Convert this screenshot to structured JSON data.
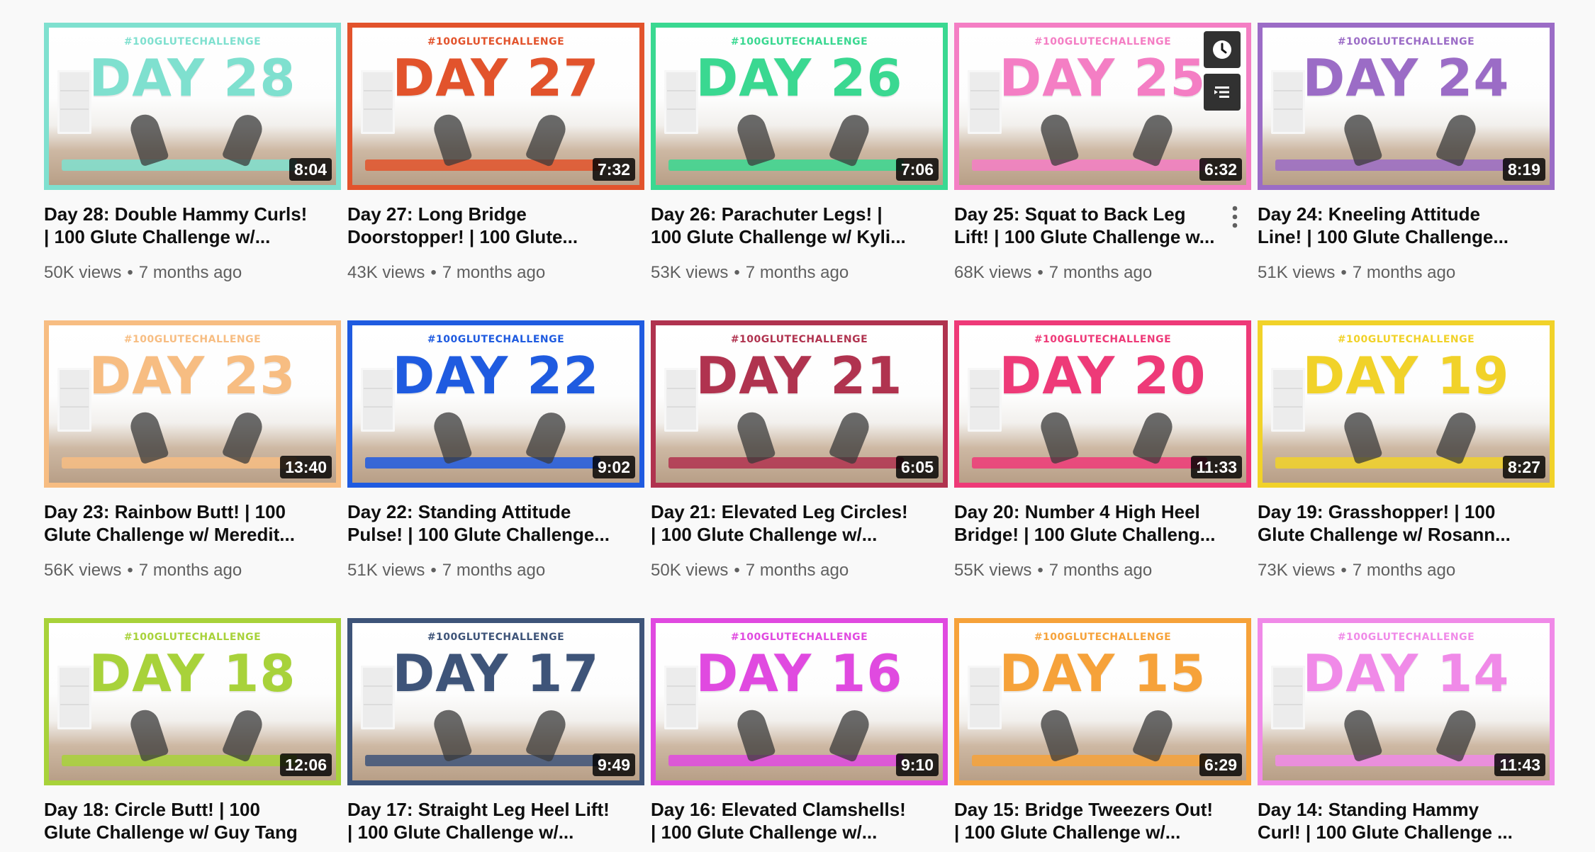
{
  "videos": [
    {
      "tag": "#100GLUTECHALLENGE",
      "day": "DAY 28",
      "color": "#7fe0cf",
      "duration": "8:04",
      "title_line1": "Day 28: Double Hammy Curls!",
      "title_line2": "| 100 Glute Challenge w/...",
      "views": "50K views",
      "age": "7 months ago"
    },
    {
      "tag": "#100GLUTECHALLENGE",
      "day": "DAY 27",
      "color": "#e2532c",
      "duration": "7:32",
      "title_line1": "Day 27: Long Bridge",
      "title_line2": "Doorstopper! | 100 Glute...",
      "views": "43K views",
      "age": "7 months ago"
    },
    {
      "tag": "#100GLUTECHALLENGE",
      "day": "DAY 26",
      "color": "#3ad891",
      "duration": "7:06",
      "title_line1": "Day 26: Parachuter Legs! |",
      "title_line2": "100 Glute Challenge w/ Kyli...",
      "views": "53K views",
      "age": "7 months ago"
    },
    {
      "tag": "#100GLUTECHALLENGE",
      "day": "DAY 25",
      "color": "#f47ec4",
      "duration": "6:32",
      "title_line1": "Day 25: Squat to Back Leg",
      "title_line2": "Lift! | 100 Glute Challenge w...",
      "views": "68K views",
      "age": "7 months ago"
    },
    {
      "tag": "#100GLUTECHALLENGE",
      "day": "DAY 24",
      "color": "#9b6cc6",
      "duration": "8:19",
      "title_line1": "Day 24: Kneeling Attitude",
      "title_line2": "Line! | 100 Glute Challenge...",
      "views": "51K views",
      "age": "7 months ago"
    },
    {
      "tag": "#100GLUTECHALLENGE",
      "day": "DAY 23",
      "color": "#f7bd82",
      "duration": "13:40",
      "title_line1": "Day 23: Rainbow Butt! | 100",
      "title_line2": "Glute Challenge w/ Meredit...",
      "views": "56K views",
      "age": "7 months ago"
    },
    {
      "tag": "#100GLUTECHALLENGE",
      "day": "DAY 22",
      "color": "#1f5be0",
      "duration": "9:02",
      "title_line1": "Day 22: Standing Attitude",
      "title_line2": "Pulse! | 100 Glute Challenge...",
      "views": "51K views",
      "age": "7 months ago"
    },
    {
      "tag": "#100GLUTECHALLENGE",
      "day": "DAY 21",
      "color": "#b0334f",
      "duration": "6:05",
      "title_line1": "Day 21: Elevated Leg Circles!",
      "title_line2": "| 100 Glute Challenge w/...",
      "views": "50K views",
      "age": "7 months ago"
    },
    {
      "tag": "#100GLUTECHALLENGE",
      "day": "DAY 20",
      "color": "#ee3a78",
      "duration": "11:33",
      "title_line1": "Day 20: Number 4 High Heel",
      "title_line2": "Bridge! | 100 Glute Challeng...",
      "views": "55K views",
      "age": "7 months ago"
    },
    {
      "tag": "#100GLUTECHALLENGE",
      "day": "DAY 19",
      "color": "#f1d229",
      "duration": "8:27",
      "title_line1": "Day 19: Grasshopper! | 100",
      "title_line2": "Glute Challenge w/ Rosann...",
      "views": "73K views",
      "age": "7 months ago"
    },
    {
      "tag": "#100GLUTECHALLENGE",
      "day": "DAY 18",
      "color": "#a8d23a",
      "duration": "12:06",
      "title_line1": "Day 18: Circle Butt! | 100",
      "title_line2": "Glute Challenge w/ Guy Tang",
      "views": "",
      "age": ""
    },
    {
      "tag": "#100GLUTECHALLENGE",
      "day": "DAY 17",
      "color": "#3e5479",
      "duration": "9:49",
      "title_line1": "Day 17: Straight Leg Heel Lift!",
      "title_line2": "| 100 Glute Challenge w/...",
      "views": "",
      "age": ""
    },
    {
      "tag": "#100GLUTECHALLENGE",
      "day": "DAY 16",
      "color": "#e04ae0",
      "duration": "9:10",
      "title_line1": "Day 16: Elevated Clamshells!",
      "title_line2": "| 100 Glute Challenge w/...",
      "views": "",
      "age": ""
    },
    {
      "tag": "#100GLUTECHALLENGE",
      "day": "DAY 15",
      "color": "#f6a23a",
      "duration": "6:29",
      "title_line1": "Day 15: Bridge Tweezers Out!",
      "title_line2": "| 100 Glute Challenge w/...",
      "views": "",
      "age": ""
    },
    {
      "tag": "#100GLUTECHALLENGE",
      "day": "DAY 14",
      "color": "#f08ae8",
      "duration": "11:43",
      "title_line1": "Day 14: Standing Hammy",
      "title_line2": "Curl! | 100 Glute Challenge ...",
      "views": "",
      "age": ""
    }
  ],
  "hover_overlay": {
    "watch_later_icon": "clock-icon",
    "add_to_queue_icon": "queue-icon"
  },
  "menu_icon": "more-vert-icon",
  "meta_separator": "•"
}
